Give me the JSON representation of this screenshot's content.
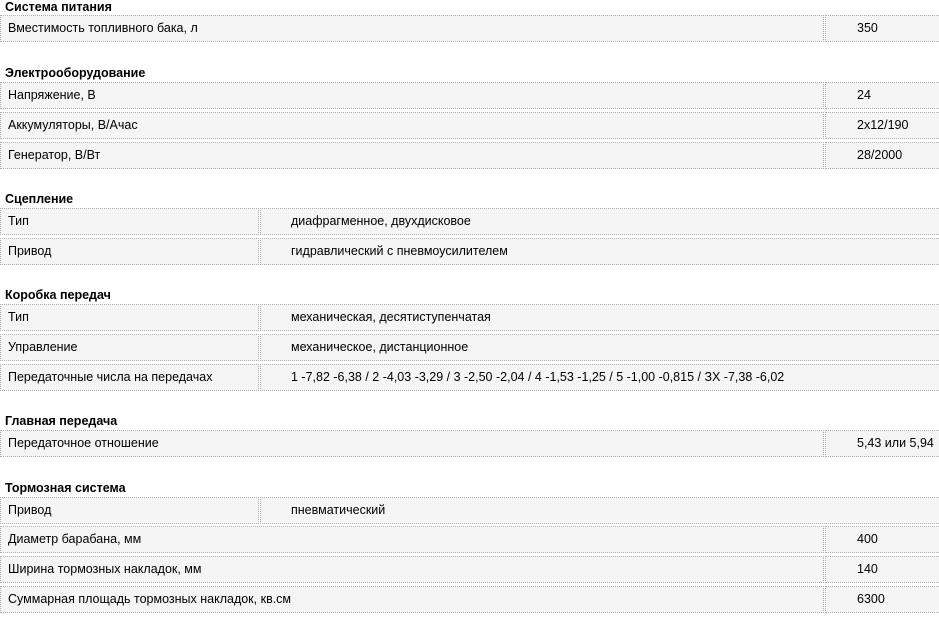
{
  "sections": {
    "fuel": {
      "title": "Система питания",
      "rows": [
        {
          "label": "Вместимость топливного бака, л",
          "value": "350"
        }
      ]
    },
    "electrical": {
      "title": "Электрооборудование",
      "rows": [
        {
          "label": "Напряжение, В",
          "value": "24"
        },
        {
          "label": "Аккумуляторы, В/Ачас",
          "value": "2x12/190"
        },
        {
          "label": "Генератор, В/Вт",
          "value": "28/2000"
        }
      ]
    },
    "clutch": {
      "title": "Сцепление",
      "rows": [
        {
          "label": "Тип",
          "value": "диафрагменное, двухдисковое"
        },
        {
          "label": "Привод",
          "value": "гидравлический с пневмоусилителем"
        }
      ]
    },
    "gearbox": {
      "title": "Коробка передач",
      "rows": [
        {
          "label": "Тип",
          "value": "механическая, десятиступенчатая"
        },
        {
          "label": "Управление",
          "value": "механическое, дистанционное"
        },
        {
          "label": "Передаточные числа на передачах",
          "value": "1 -7,82 -6,38 / 2 -4,03 -3,29 / 3 -2,50 -2,04 / 4 -1,53 -1,25 / 5 -1,00 -0,815 / ЗХ -7,38 -6,02"
        }
      ]
    },
    "final_drive": {
      "title": "Главная передача",
      "rows": [
        {
          "label": "Передаточное отношение",
          "value": "5,43 или 5,94"
        }
      ]
    },
    "brakes": {
      "title": "Тормозная система",
      "rows": [
        {
          "label": "Привод",
          "value": "пневматический"
        },
        {
          "label": "Диаметр барабана, мм",
          "value": "400"
        },
        {
          "label": "Ширина тормозных накладок, мм",
          "value": "140"
        },
        {
          "label": "Суммарная площадь тормозных накладок, кв.см",
          "value": "6300"
        }
      ]
    }
  }
}
